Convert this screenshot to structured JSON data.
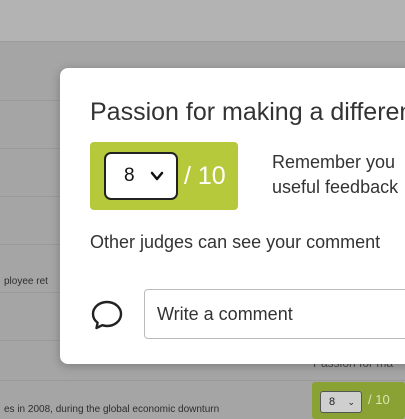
{
  "background": {
    "snippet_left": "ployee ret",
    "bottom_text": "es in 2008, during the global economic downturn",
    "passion_label": "Passion for ma",
    "score": {
      "selected": "8",
      "chevron": "⌄",
      "out_of": "/ 10"
    }
  },
  "modal": {
    "title": "Passion for making a differenc",
    "score": {
      "selected": "8",
      "out_of": "/ 10",
      "box_color": "#b5c93a"
    },
    "reminder_line1": "Remember you",
    "reminder_line2": "useful feedback",
    "visibility_note": "Other judges can see your comment",
    "comment": {
      "icon": "speech-bubble-icon",
      "placeholder": "Write a comment"
    }
  }
}
